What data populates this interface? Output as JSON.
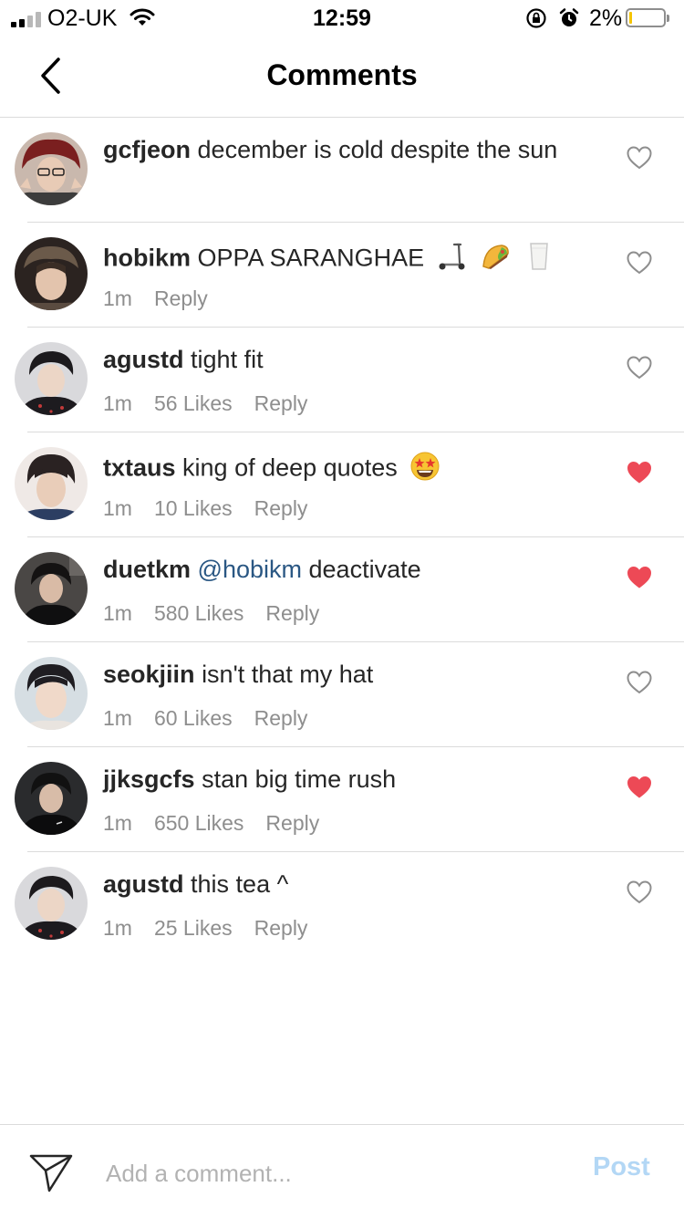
{
  "status_bar": {
    "carrier": "O2-UK",
    "time": "12:59",
    "battery_percent": "2%",
    "battery_level": 0.02
  },
  "header": {
    "title": "Comments"
  },
  "comments": [
    {
      "username": "gcfjeon",
      "text": "december is cold despite the sun",
      "mention": "",
      "time": "",
      "likes": "",
      "reply": "",
      "liked": false
    },
    {
      "username": "hobikm",
      "text": "OPPA SARANGHAE",
      "mention": "",
      "emojis": [
        "scooter",
        "taco",
        "milk"
      ],
      "time": "1m",
      "likes": "",
      "reply": "Reply",
      "liked": false
    },
    {
      "username": "agustd",
      "text": "tight fit",
      "mention": "",
      "time": "1m",
      "likes": "56 Likes",
      "reply": "Reply",
      "liked": false
    },
    {
      "username": "txtaus",
      "text": "king of deep quotes",
      "mention": "",
      "emojis": [
        "star-struck"
      ],
      "time": "1m",
      "likes": "10 Likes",
      "reply": "Reply",
      "liked": true
    },
    {
      "username": "duetkm",
      "text": "deactivate",
      "mention": "@hobikm",
      "time": "1m",
      "likes": "580 Likes",
      "reply": "Reply",
      "liked": true
    },
    {
      "username": "seokjiin",
      "text": "isn't that my hat",
      "mention": "",
      "time": "1m",
      "likes": "60 Likes",
      "reply": "Reply",
      "liked": false
    },
    {
      "username": "jjksgcfs",
      "text": "stan big time rush",
      "mention": "",
      "time": "1m",
      "likes": "650 Likes",
      "reply": "Reply",
      "liked": true
    },
    {
      "username": "agustd",
      "text": "this tea ^",
      "mention": "",
      "time": "1m",
      "likes": "25 Likes",
      "reply": "Reply",
      "liked": false
    }
  ],
  "composer": {
    "placeholder": "Add a comment...",
    "post_label": "Post"
  },
  "colors": {
    "heart_liked": "#ed4956",
    "mention": "#2a5783",
    "post_disabled": "#b3d7f5",
    "meta_text": "#8e8e8e"
  }
}
